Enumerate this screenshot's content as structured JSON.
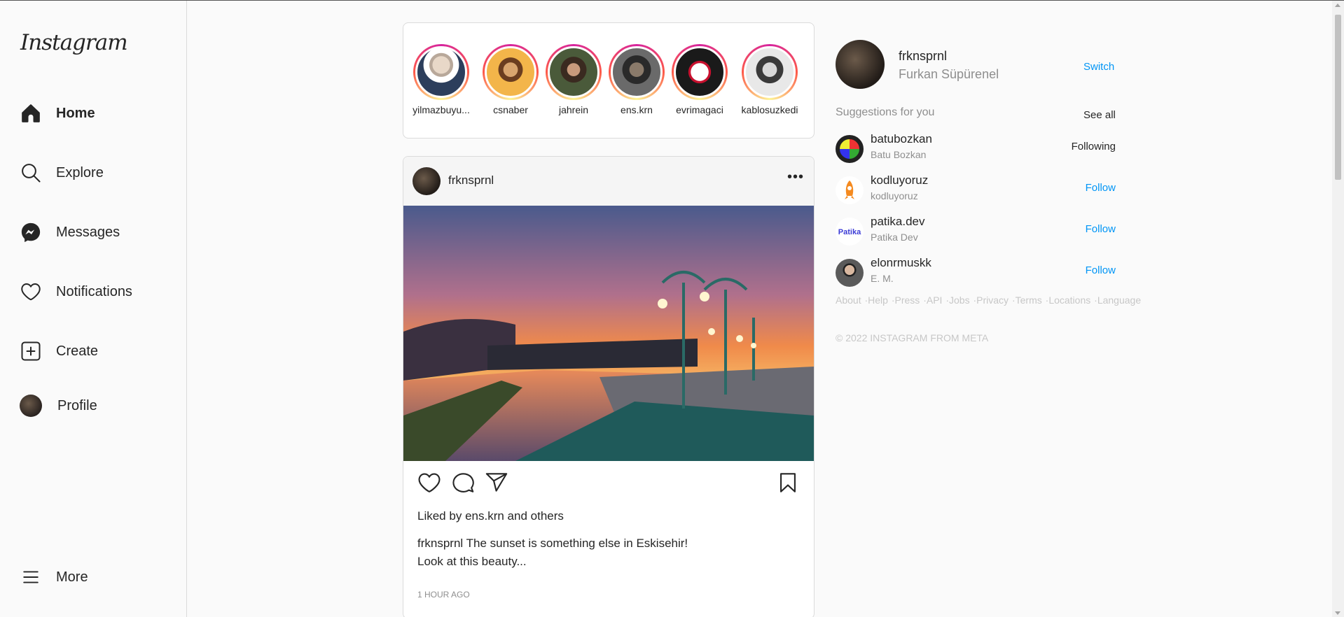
{
  "sidebar": {
    "logo": "Instagram",
    "items": [
      {
        "label": "Home",
        "icon": "home-icon"
      },
      {
        "label": "Explore",
        "icon": "search-icon"
      },
      {
        "label": "Messages",
        "icon": "messenger-icon"
      },
      {
        "label": "Notifications",
        "icon": "heart-icon"
      },
      {
        "label": "Create",
        "icon": "plus-square-icon"
      },
      {
        "label": "Profile",
        "icon": "avatar"
      }
    ],
    "more": "More"
  },
  "stories": [
    {
      "name": "yilmazbuyu..."
    },
    {
      "name": "csnaber"
    },
    {
      "name": "jahrein"
    },
    {
      "name": "ens.krn"
    },
    {
      "name": "evrimagaci"
    },
    {
      "name": "kablosuzkedi"
    }
  ],
  "post": {
    "username": "frknsprnl",
    "more": "•••",
    "liked_prefix": "Liked by",
    "liked_user": "ens.krn",
    "liked_and": "and",
    "liked_others": "others",
    "caption_user": "frknsprnl",
    "caption_line1": "The sunset is something else in Eskisehir!",
    "caption_line2": "Look at this beauty...",
    "time": "1 HOUR AGO"
  },
  "profile": {
    "username": "frknsprnl",
    "full_name": "Furkan Süpürenel",
    "switch": "Switch"
  },
  "suggestions": {
    "title": "Suggestions for you",
    "see_all": "See all",
    "items": [
      {
        "username": "batubozkan",
        "name": "Batu Bozkan",
        "action": "Following"
      },
      {
        "username": "kodluyoruz",
        "name": "kodluyoruz",
        "action": "Follow"
      },
      {
        "username": "patika.dev",
        "name": "Patika Dev",
        "action": "Follow"
      },
      {
        "username": "elonrmuskk",
        "name": "E. M.",
        "action": "Follow"
      }
    ]
  },
  "footer": {
    "links": [
      "About",
      "Help",
      "Press",
      "API",
      "Jobs",
      "Privacy",
      "Terms",
      "Locations",
      "Language"
    ],
    "copyright": "© 2022 INSTAGRAM FROM META"
  },
  "colors": {
    "accent": "#0095f6",
    "story_ring": "#d6249f"
  }
}
